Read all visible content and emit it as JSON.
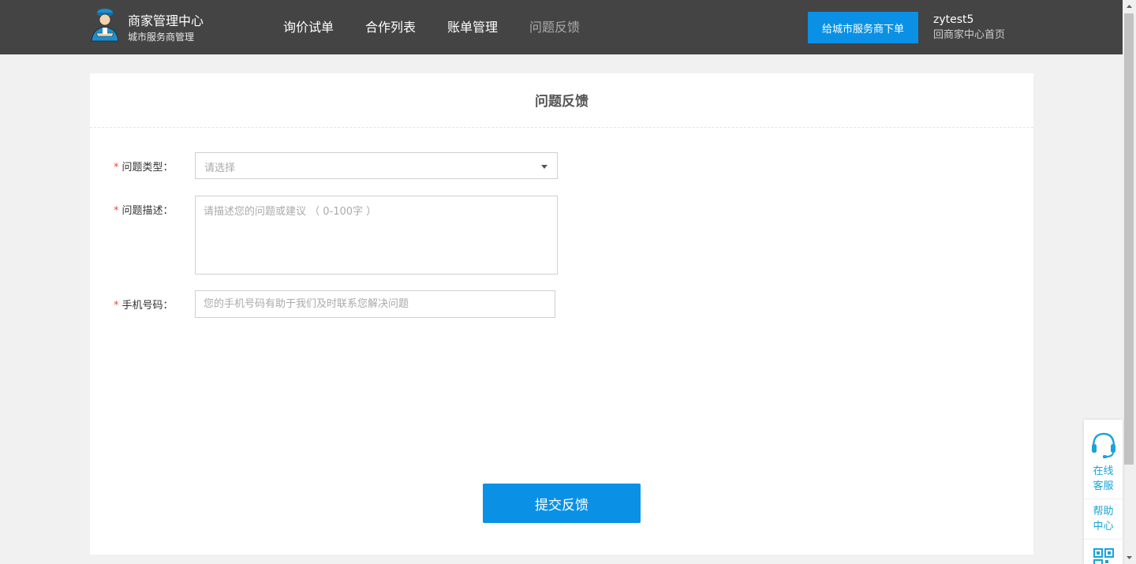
{
  "header": {
    "brand_title": "商家管理中心",
    "brand_subtitle": "城市服务商管理",
    "nav": [
      {
        "label": "询价试单",
        "active": false
      },
      {
        "label": "合作列表",
        "active": false
      },
      {
        "label": "账单管理",
        "active": false
      },
      {
        "label": "问题反馈",
        "active": true
      }
    ],
    "order_button_label": "给城市服务商下单",
    "username": "zytest5",
    "home_link": "回商家中心首页"
  },
  "form": {
    "title": "问题反馈",
    "required_mark": "*",
    "type_label": "问题类型：",
    "type_placeholder": "请选择",
    "desc_label": "问题描述：",
    "desc_placeholder": "请描述您的问题或建议 （ 0-100字 ）",
    "phone_label": "手机号码：",
    "phone_placeholder": "您的手机号码有助于我们及时联系您解决问题",
    "submit_label": "提交反馈"
  },
  "side_widget": {
    "service_label": "在线客服",
    "help_label": "帮助中心"
  },
  "colors": {
    "header_bg": "#444444",
    "primary": "#0a91e6",
    "accent_cyan": "#1aa3d9",
    "required": "#e74c3c"
  }
}
